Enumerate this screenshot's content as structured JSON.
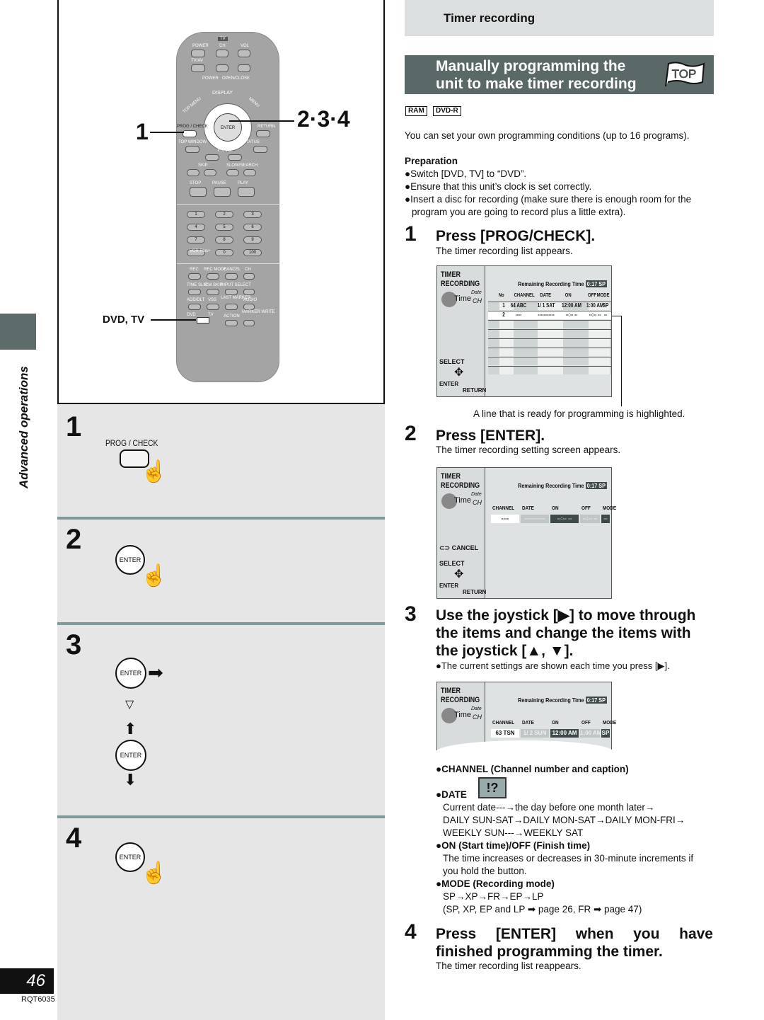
{
  "sidebar": {
    "section_label": "Advanced operations",
    "page_number": "46",
    "doc_code": "RQT6035"
  },
  "remote": {
    "callouts": {
      "step1": "1",
      "steps234": "2·3·4",
      "dvd_tv": "DVD, TV"
    },
    "labels": {
      "tv": "TV",
      "power_tv": "POWER",
      "ch": "CH",
      "vol": "VOL",
      "tvav": "TV/AV",
      "power": "POWER",
      "open_close": "OPEN/CLOSE",
      "display": "DISPLAY",
      "direct_navigator": "DIRECT NAVIGATOR",
      "top_menu": "TOP MENU",
      "menu": "MENU",
      "play_list": "PLAY LIST",
      "enter": "ENTER",
      "prog_check": "PROG / CHECK",
      "return": "RETURN",
      "top_window": "TOP WINDOW",
      "status": "STATUS",
      "frame": "FRAME",
      "skip": "SKIP",
      "slow_search": "SLOW/SEARCH",
      "stop": "STOP",
      "pause": "PAUSE",
      "play": "PLAY",
      "digits": [
        "1",
        "2",
        "3",
        "4",
        "5",
        "6",
        "7",
        "8",
        "9",
        "0",
        "100"
      ],
      "vcr_plus": "VCR Plus+",
      "rec": "REC",
      "rec_mode": "REC MODE",
      "cancel": "CANCEL",
      "dvd_ch": "CH",
      "time_slip": "TIME SLIP",
      "cm_skip": "CM SKIP",
      "input_select": "INPUT SELECT",
      "add_dlt": "ADD/DLT",
      "vss": "VSS",
      "last_marker": "LAST MARKER",
      "audio": "AUDIO",
      "dvd_sw": "DVD",
      "tv_sw": "TV",
      "action": "ACTION",
      "marker_write": "MARKER WRITE"
    }
  },
  "left_steps": [
    {
      "num": "1",
      "button_label": "PROG / CHECK"
    },
    {
      "num": "2",
      "button_label": "ENTER"
    },
    {
      "num": "3",
      "button_label": "ENTER"
    },
    {
      "num": "4",
      "button_label": "ENTER"
    }
  ],
  "header": {
    "section": "Timer recording",
    "title_line1": "Manually programming the",
    "title_line2": "unit to make timer recording",
    "top_badge": "TOP",
    "disc_tags": [
      "RAM",
      "DVD-R"
    ]
  },
  "intro": "You can set your own programming conditions (up to 16 programs).",
  "preparation": {
    "heading": "Preparation",
    "items": [
      "●Switch [DVD, TV] to “DVD”.",
      "●Ensure that this unit’s clock is set correctly.",
      "●Insert a disc for recording (make sure there is enough room for the",
      "program you are going to record plus a little extra)."
    ]
  },
  "steps": [
    {
      "num": "1",
      "title": "Press [PROG/CHECK].",
      "sub": "The timer recording list appears."
    },
    {
      "num": "2",
      "title": "Press [ENTER].",
      "sub": "The timer recording setting screen appears."
    },
    {
      "num": "3",
      "title_lines": [
        "Use the joystick [▶] to move through",
        "the items and change the items with",
        "the joystick [▲, ▼]."
      ],
      "sub": "●The current settings are shown each time you press [▶]."
    },
    {
      "num": "4",
      "title_lines": [
        "Press [ENTER] when you have",
        "finished programming the timer."
      ],
      "sub": "The timer recording list reappears."
    }
  ],
  "osd_common": {
    "title1": "TIMER",
    "title2": "RECORDING",
    "time_word": "Time",
    "date_word": "Date",
    "ch_word": "CH",
    "remaining_label": "Remaining Recording Time",
    "remaining_value": "0:17 SP",
    "select": "SELECT",
    "enter": "ENTER",
    "return": "RETURN",
    "cancel": "CANCEL"
  },
  "osd_list": {
    "headers": [
      "No",
      "CHANNEL",
      "DATE",
      "ON",
      "OFF",
      "MODE"
    ],
    "rows": [
      [
        "1",
        "64  ABC",
        "1/  1 SAT",
        "12:00 AM",
        "1:00 AM",
        "SP"
      ],
      [
        "2",
        "----",
        "-----------",
        "--:-- --",
        "--:-- --",
        "--"
      ]
    ],
    "caption": "A line that is ready for programming is highlighted."
  },
  "osd_setting": {
    "headers": [
      "CHANNEL",
      "DATE",
      "ON",
      "OFF",
      "MODE"
    ],
    "values": [
      "----",
      "-----------",
      "--:-- --",
      "--:-- --",
      "--"
    ]
  },
  "osd_example": {
    "headers": [
      "CHANNEL",
      "DATE",
      "ON",
      "OFF",
      "MODE"
    ],
    "values": [
      "63  TSN",
      "1/  2 SUN",
      "12:00 AM",
      "1:00 AM",
      "SP"
    ]
  },
  "options": {
    "channel": "●CHANNEL (Channel number and caption)",
    "date": "●DATE",
    "date_icon": "!?",
    "date_desc": [
      "Current  date---→the  day  before  one  month  later→",
      "DAILY SUN-SAT→DAILY MON-SAT→DAILY MON-FRI→",
      "WEEKLY SUN---→WEEKLY SAT"
    ],
    "onoff": "●ON (Start time)/OFF (Finish time)",
    "onoff_desc": [
      "The time increases or decreases in 30-minute increments if",
      "you hold the button."
    ],
    "mode": "●MODE (Recording mode)",
    "mode_desc": [
      "SP→XP→FR→EP→LP",
      "(SP, XP, EP and LP ➡ page 26, FR ➡ page 47)"
    ]
  }
}
